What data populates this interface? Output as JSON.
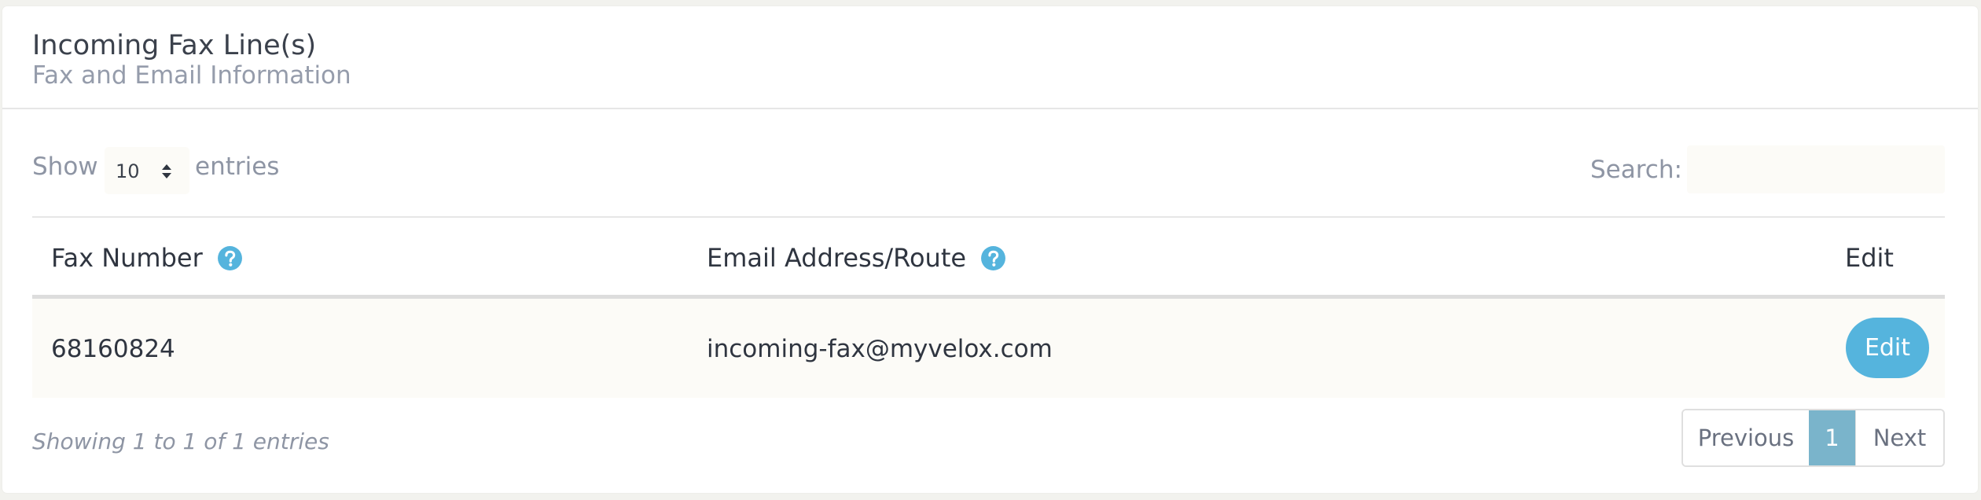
{
  "panel": {
    "title": "Incoming Fax Line(s)",
    "subtitle": "Fax and Email Information"
  },
  "length": {
    "show_label": "Show",
    "value": "10",
    "entries_label": "entries"
  },
  "search": {
    "label": "Search:",
    "value": ""
  },
  "table": {
    "headers": {
      "fax": "Fax Number",
      "email": "Email Address/Route",
      "edit": "Edit"
    },
    "rows": [
      {
        "fax": "68160824",
        "email": "incoming-fax@myvelox.com",
        "edit_label": "Edit"
      }
    ]
  },
  "footer": {
    "info": "Showing 1 to 1 of 1 entries",
    "pagination": {
      "previous": "Previous",
      "current": "1",
      "next": "Next"
    }
  },
  "colors": {
    "accent": "#55b4dd",
    "active_page": "#7ab4cb",
    "row_background": "#fcfbf7"
  },
  "icons": {
    "help": "question-circle-icon",
    "sort": "sort-arrows-icon"
  }
}
